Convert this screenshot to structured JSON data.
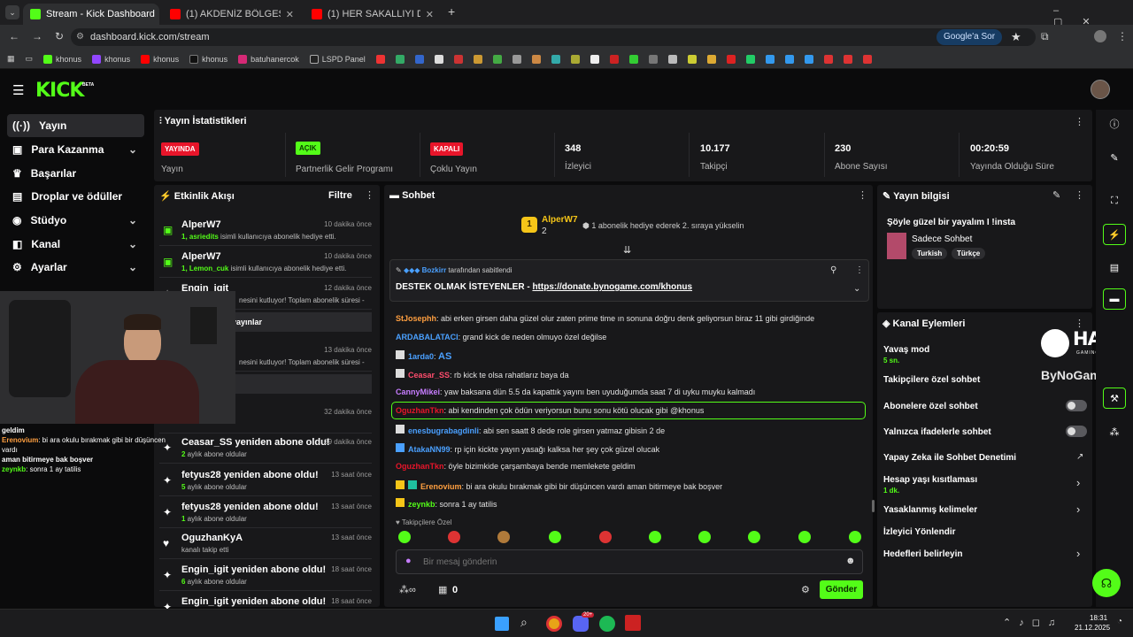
{
  "browser": {
    "tabs": [
      {
        "label": "Stream - Kick Dashboard"
      },
      {
        "label": "(1) AKDENİZ BÖLGESİ'NİN EN B"
      },
      {
        "label": "(1) HER SAKALLIYI DEDEN SAN"
      }
    ],
    "url": "dashboard.kick.com/stream",
    "google_btn": "Google'a Sor",
    "bookmarks": [
      "khonus",
      "khonus",
      "khonus",
      "khonus",
      "batuhanercok",
      "LSPD Panel"
    ]
  },
  "kick": {
    "logo": "KICK",
    "beta": "BETA"
  },
  "sidebar": {
    "items": [
      {
        "label": "Yayın"
      },
      {
        "label": "Para Kazanma"
      },
      {
        "label": "Başarılar"
      },
      {
        "label": "Droplar ve ödüller"
      },
      {
        "label": "Stüdyo"
      },
      {
        "label": "Kanal"
      },
      {
        "label": "Ayarlar"
      }
    ]
  },
  "stats": {
    "title": "Yayın İstatistikleri",
    "items": [
      {
        "badge": "YAYINDA",
        "label": "Yayın",
        "color": "#e8152a"
      },
      {
        "badge": "AÇIK",
        "label": "Partnerlik Gelir Programı",
        "color": "#53fc18"
      },
      {
        "badge": "KAPALI",
        "label": "Çoklu Yayın",
        "color": "#e8152a"
      },
      {
        "value": "348",
        "label": "İzleyici"
      },
      {
        "value": "10.177",
        "label": "Takipçi"
      },
      {
        "value": "230",
        "label": "Abone Sayısı"
      },
      {
        "value": "00:20:59",
        "label": "Yayında Olduğu Süre"
      }
    ]
  },
  "activity": {
    "title": "Etkinlik Akışı",
    "filter": "Filtre",
    "events": [
      {
        "name": "AlperW7",
        "time": "10 dakika önce",
        "sub_user": "1, asriedits",
        "sub_text": " isimli kullanıcıya abonelik hediye etti."
      },
      {
        "name": "AlperW7",
        "time": "10 dakika önce",
        "sub_user": "1, Lemon_cuk",
        "sub_text": " isimli kullanıcıya abonelik hediye etti."
      },
      {
        "name": "Engin_igit",
        "time": "12 dakika önce",
        "sub_text": "nesini kutluyor! Toplam abonelik süresi -"
      },
      {
        "name": "",
        "time": "13 dakika önce",
        "sub_text": "nesini kutluyor! Toplam abonelik süresi -"
      },
      {
        "name": "",
        "time": "32 dakika önce",
        "sub_text": ""
      },
      {
        "name": "Ceasar_SS yeniden abone oldu!",
        "time": "39 dakika önce",
        "sub_user": "2",
        "sub_text": " aylık abone oldular"
      },
      {
        "name": "fetyus28 yeniden abone oldu!",
        "time": "13 saat önce",
        "sub_user": "5",
        "sub_text": " aylık abone oldular"
      },
      {
        "name": "fetyus28 yeniden abone oldu!",
        "time": "13 saat önce",
        "sub_user": "1",
        "sub_text": " aylık abone oldular"
      },
      {
        "name": "OguzhanKyA",
        "time": "13 saat önce",
        "sub_text": "kanalı takip etti"
      },
      {
        "name": "Engin_igit yeniden abone oldu!",
        "time": "18 saat önce",
        "sub_user": "6",
        "sub_text": " aylık abone oldular"
      },
      {
        "name": "Engin_igit yeniden abone oldu!",
        "time": "18 saat önce",
        "sub_text": ""
      }
    ],
    "overlay_text": "yayınlar"
  },
  "cam_overlay": {
    "lines": [
      {
        "user": "",
        "text": "geldim"
      },
      {
        "user": "Erenovium",
        "text": ": bi ara okulu bırakmak gibi bir düşüncen vardı"
      },
      {
        "user": "",
        "text": "aman bitirmeye bak boşver"
      },
      {
        "user": "zeynkb",
        "text": ": sonra 1 ay tatilis"
      }
    ],
    "hawk": "HAWK",
    "hawk_sub": "GAMING CHAIR",
    "bynogame": "ByNoGame"
  },
  "chat": {
    "title": "Sohbet",
    "gifter": {
      "name": "AlperW7",
      "count": "2",
      "rank": "1",
      "text": "1 abonelik hediye ederek 2. sıraya yükselin"
    },
    "pinned": {
      "by_user": "Bozkirr",
      "by_text": " tarafından sabitlendi",
      "text": "DESTEK OLMAK İSTEYENLER - ",
      "link": "https://donate.bynogame.com/khonus"
    },
    "messages": [
      {
        "user": "StJosephh",
        "color": "#ff9f40",
        "text": ": abi erken girsen daha güzel olur zaten prime time ın sonuna doğru denk geliyorsun biraz 11 gibi girdiğinde"
      },
      {
        "user": "ARDABALATACI",
        "color": "#4aa0ff",
        "text": ": grand kick de neden olmuyo özel değilse"
      },
      {
        "user": "1arda0",
        "color": "#4aa0ff",
        "text": ": ",
        "extra": "AS"
      },
      {
        "user": "Ceasar_SS",
        "color": "#ff4d6d",
        "text": ": rb kick te olsa rahatlarız baya da"
      },
      {
        "user": "CannyMikei",
        "color": "#c77dff",
        "text": ": yaw baksana dün 5.5 da kapattık yayını ben uyuduğumda saat 7 di uyku muyku kalmadı"
      },
      {
        "user": "OguzhanTkn",
        "color": "#e8152a",
        "text": ": abi kendinden çok ödün veriyorsun bunu sonu kötü olucak gibi @khonus"
      },
      {
        "user": "enesbugrabagdinli",
        "color": "#4aa0ff",
        "text": ": abi sen saatt 8 dede role girsen yatmaz gibisin 2 de"
      },
      {
        "user": "AtakaNN99",
        "color": "#4aa0ff",
        "text": ": rp için kickte yayın yasağı kalksa her şey çok güzel olucak"
      },
      {
        "user": "OguzhanTkn",
        "color": "#e8152a",
        "text": ": öyle bizimkide çarşambaya bende memlekete geldim"
      },
      {
        "user": "Erenovium",
        "color": "#ff9f40",
        "text": ": bi ara okulu bırakmak gibi bir düşüncen vardı aman bitirmeye bak boşver"
      },
      {
        "user": "zeynkb",
        "color": "#53fc18",
        "text": ": sonra 1 ay tatilis"
      }
    ],
    "followers_only": "Takipçilere Özel",
    "placeholder": "Bir mesaj gönderin",
    "points": "0",
    "send": "Gönder"
  },
  "info": {
    "title": "Yayın bilgisi",
    "stream_title": "Şöyle güzel bir yayalım I !insta",
    "category": "Sadece Sohbet",
    "tags": [
      "Turkish",
      "Türkçe"
    ]
  },
  "actions": {
    "title": "Kanal Eylemleri",
    "items": [
      {
        "label": "Yavaş mod",
        "sub": "5 sn."
      },
      {
        "label": "Takipçilere özel sohbet"
      },
      {
        "label": "Abonelere özel sohbet"
      },
      {
        "label": "Yalnızca ifadelerle sohbet"
      },
      {
        "label": "Yapay Zeka ile Sohbet Denetimi"
      },
      {
        "label": "Hesap yaşı kısıtlaması",
        "sub": "1 dk."
      },
      {
        "label": "Yasaklanmış kelimeler"
      },
      {
        "label": "İzleyici Yönlendir"
      },
      {
        "label": "Hedefleri belirleyin"
      }
    ]
  },
  "taskbar": {
    "time": "18:31",
    "date": "21.12.2025",
    "badge": "20+"
  }
}
